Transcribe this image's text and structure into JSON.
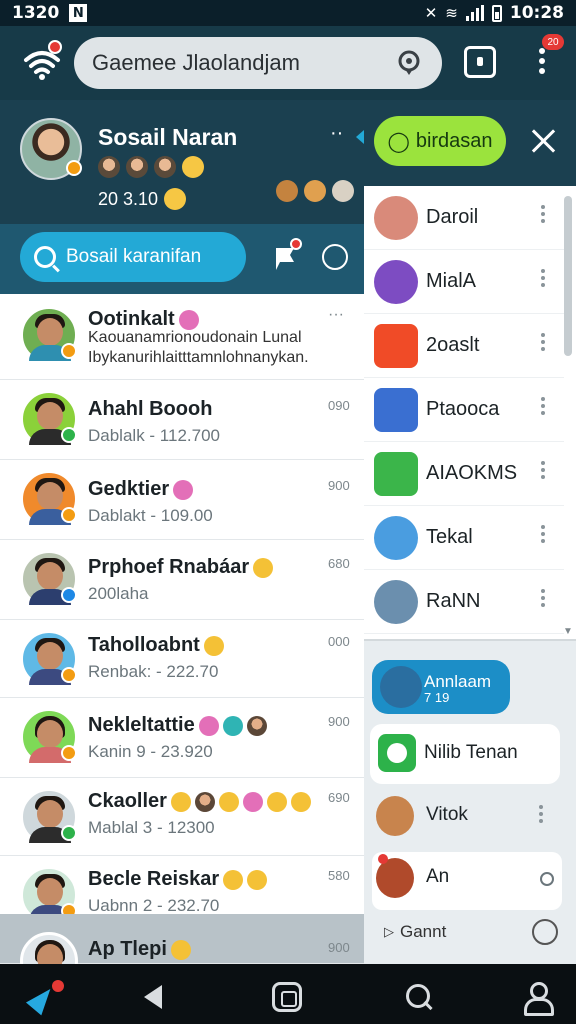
{
  "status_bar": {
    "time_left": "1320",
    "n_label": "N",
    "time_right": "10:28"
  },
  "app_bar": {
    "search_text": "Gaemee Jlaolandjam",
    "badge": "20"
  },
  "profile": {
    "name": "Sosail Naran",
    "stat": "20 3.10",
    "dots": "··"
  },
  "action_bar": {
    "pill_label": "Bosail karanifan"
  },
  "chats": [
    {
      "name": "Ootinkalt",
      "preview": "Kaouanamrionoudonain Lunal Ibykanurihlaitttamnlohnanykan.",
      "time": "···",
      "avatar_color": "#6fae52",
      "mini_color": "#f39c12"
    },
    {
      "name": "Ahahl Boooh",
      "sub": "Dablalk - 112.700",
      "time": "090",
      "avatar_color": "#8bd13a",
      "mini_color": "#2db24a"
    },
    {
      "name": "Gedktier",
      "sub": "Dablakt - 109.00",
      "time": "900",
      "avatar_color": "#f08a2c",
      "mini_color": "#f39c12"
    },
    {
      "name": "Prphoef Rnabáar",
      "sub": "200laha",
      "time": "680",
      "avatar_color": "#b9c4b0",
      "mini_color": "#1e88e5"
    },
    {
      "name": "Taholloabnt",
      "sub": "Renbak: - 222.70",
      "time": "000",
      "avatar_color": "#5fb9e6",
      "mini_color": "#f39c12"
    },
    {
      "name": "Nekleltattie",
      "sub": "Kanin 9 - 23.920",
      "time": "900",
      "avatar_color": "#7ed957",
      "mini_color": "#f39c12"
    },
    {
      "name": "Ckaoller",
      "sub": "Mablal 3 - 12300",
      "time": "690",
      "avatar_color": "#cfd8dc",
      "mini_color": "#2db24a"
    },
    {
      "name": "Becle Reiskar",
      "sub": "Uabnn 2 - 232.70",
      "time": "580",
      "avatar_color": "#cfe8d9",
      "mini_color": "#f39c12"
    },
    {
      "name": "Ap Tlepi",
      "time": "900",
      "avatar_color": "#e0e6ea",
      "mini_color": "#f39c12"
    }
  ],
  "side_panel": {
    "bubble_label": "birdasan",
    "items": [
      {
        "label": "Daroil",
        "icon_color": "#d98a7a"
      },
      {
        "label": "MialA",
        "icon_color": "#7d4cc2"
      },
      {
        "label": "2oaslt",
        "icon_color": "#f04b27"
      },
      {
        "label": "Ptaooca",
        "icon_color": "#3a6fd1"
      },
      {
        "label": "AIAOKMS",
        "icon_color": "#3bb54a"
      },
      {
        "label": "Tekal",
        "icon_color": "#4a9de0"
      },
      {
        "label": "RaNN",
        "icon_color": "#6b8fae"
      }
    ],
    "card_blue": {
      "label": "Annlaam",
      "sub": "7 19"
    },
    "card_white": {
      "label": "Nilib Tenan"
    },
    "row_vitak": {
      "label": "Vitok"
    },
    "row_an": {
      "label": "An",
      "value": "0"
    },
    "footer": {
      "play": "▷",
      "label": "Gannt"
    }
  }
}
